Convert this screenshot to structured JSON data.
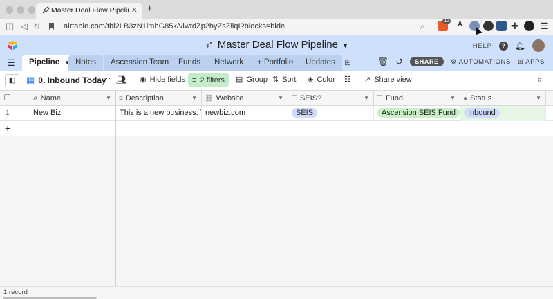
{
  "browser": {
    "tab_title": "Master Deal Flow Pipeline: Pipe",
    "tab_close": "✕",
    "new_tab": "+",
    "url": "airtable.com/tbl2LB3zN1imhG85k/viwtdZp2hyZsZliqI?blocks=hide",
    "ext_badge": "12"
  },
  "app": {
    "base_title": "Master Deal Flow Pipeline",
    "help_label": "HELP",
    "help_icon": "?"
  },
  "tabs": [
    {
      "label": "Pipeline"
    },
    {
      "label": "Notes"
    },
    {
      "label": "Ascension Team"
    },
    {
      "label": "Funds"
    },
    {
      "label": "Network"
    },
    {
      "label": "+ Portfolio"
    },
    {
      "label": "Updates"
    }
  ],
  "toolbar": {
    "share_label": "SHARE",
    "automations_label": "AUTOMATIONS",
    "apps_label": "APPS"
  },
  "viewbar": {
    "view_name": "0. Inbound Today",
    "more": "···",
    "hide_fields": "Hide fields",
    "filters": "2 filters",
    "group": "Group",
    "sort": "Sort",
    "color": "Color",
    "share_view": "Share view"
  },
  "columns": [
    {
      "label": "Name",
      "icon": "A"
    },
    {
      "label": "Description",
      "icon": "≡"
    },
    {
      "label": "Website",
      "icon": "🔗"
    },
    {
      "label": "SEIS?",
      "icon": "☰"
    },
    {
      "label": "Fund",
      "icon": "☰"
    },
    {
      "label": "Status",
      "icon": "●"
    }
  ],
  "rows": [
    {
      "num": "1",
      "name": "New Biz",
      "description": "This is a new business. Th...",
      "website": "newbiz.com",
      "seis": "SEIS",
      "fund": "Ascension SEIS Fund",
      "status": "Inbound"
    }
  ],
  "add_row": "+",
  "footer": {
    "record_count": "1 record"
  },
  "colors": {
    "header_bg": "#cfe0fc",
    "filter_bg": "#c4eccb",
    "seis_pill": "#cfdcf9",
    "fund_pill": "#c9f0c6",
    "status_pill": "#cfdcf9",
    "status_cell": "#e6f6e4"
  }
}
